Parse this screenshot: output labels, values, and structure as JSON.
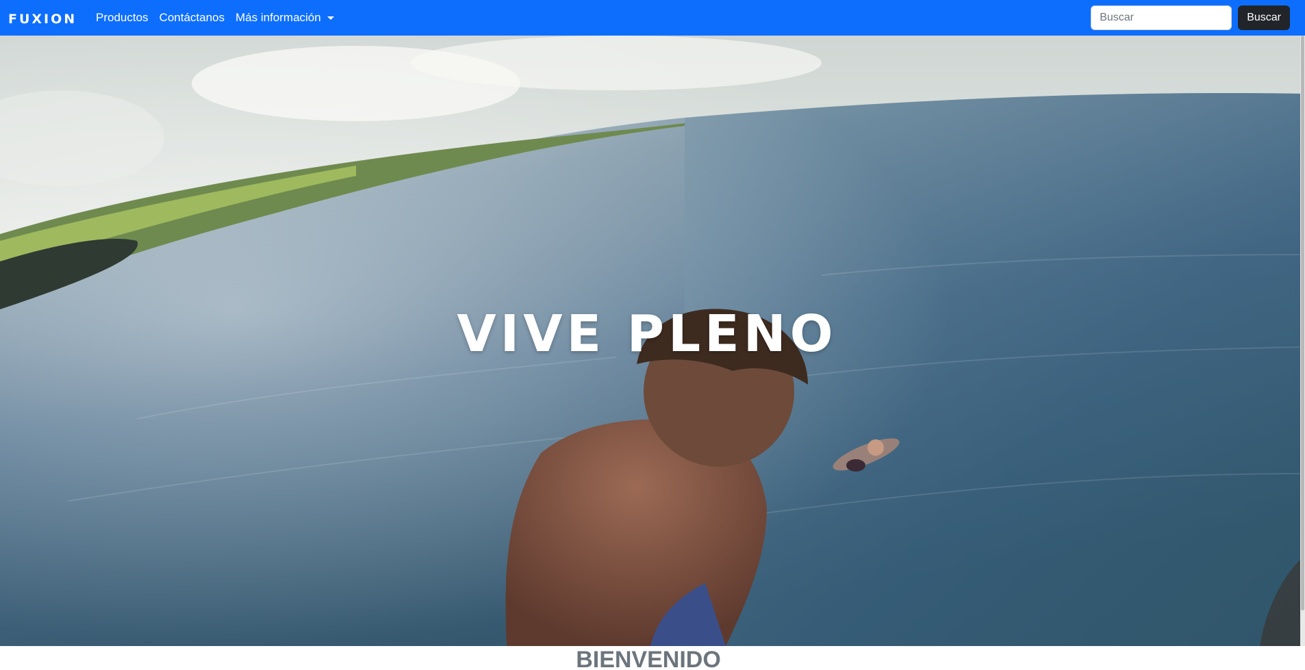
{
  "navbar": {
    "brand": "FUXION",
    "links": [
      {
        "label": "Productos"
      },
      {
        "label": "Contáctanos"
      },
      {
        "label": "Más información"
      }
    ],
    "search": {
      "placeholder": "Buscar",
      "value": "",
      "button_label": "Buscar"
    }
  },
  "hero": {
    "title": "VIVE PLENO"
  },
  "welcome": {
    "title": "BIENVENIDO"
  },
  "colors": {
    "navbar_bg": "#0d6efd",
    "search_button_bg": "#212529",
    "welcome_text": "#6c757d"
  }
}
